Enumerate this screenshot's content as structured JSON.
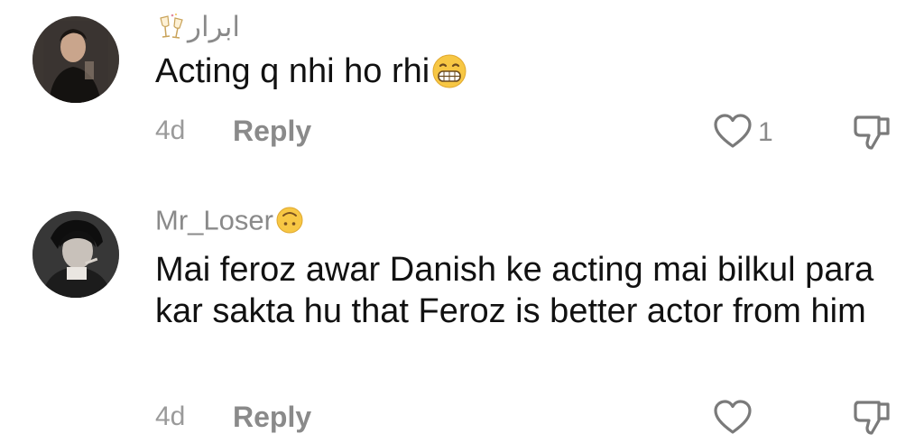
{
  "comments": [
    {
      "username": "ابرار",
      "username_icon": "champagne-glasses-icon",
      "text": "Acting q nhi ho rhi",
      "text_icon": "grinning-face-emoji",
      "time": "4d",
      "reply_label": "Reply",
      "like_count": "1"
    },
    {
      "username": "Mr_Loser",
      "username_icon": "upside-down-face-emoji",
      "text": "Mai feroz awar Danish ke acting mai bilkul para kar sakta hu that Feroz is better actor from him",
      "time": "4d",
      "reply_label": "Reply",
      "like_count": ""
    }
  ],
  "colors": {
    "username": "#8a8a8a",
    "text": "#111111",
    "meta": "#9a9a9a",
    "icon_stroke": "#7a7a7a",
    "emoji_yellow": "#f7c744"
  }
}
